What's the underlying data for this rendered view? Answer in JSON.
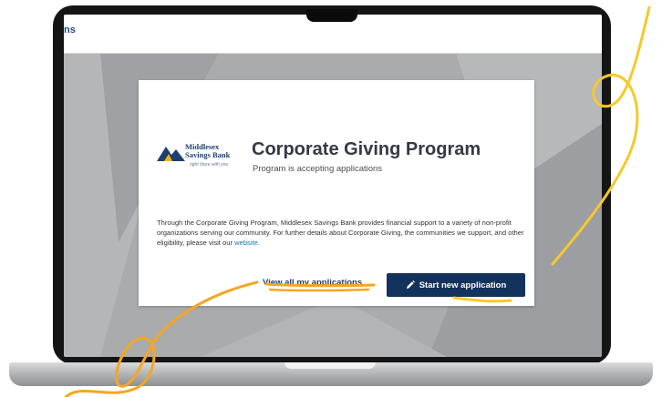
{
  "top_bar": {
    "text": "ns"
  },
  "card": {
    "logo": {
      "name_line1": "Middlesex",
      "name_line2": "Savings Bank",
      "tagline": "right there with you"
    },
    "title": "Corporate Giving Program",
    "subtitle": "Program is accepting applications",
    "description": "Through the Corporate Giving Program, Middlesex Savings Bank provides financial support to a variety of non-profit organizations serving our community. For further details about Corporate Giving, the communities we support, and other eligibility, please visit our ",
    "link_text": "website",
    "link_suffix": ".",
    "buttons": {
      "view_all": "View all my applications",
      "start_new": "Start new application"
    }
  },
  "icons": {
    "logo": "middlesex-logo-icon",
    "start_button": "pencil-icon"
  },
  "colors": {
    "brand_navy": "#13325c",
    "link_blue": "#1a73b5",
    "doodle_yellow": "#f7c92a",
    "doodle_orange": "#f5a623",
    "screen_bg": "#a9abad"
  }
}
